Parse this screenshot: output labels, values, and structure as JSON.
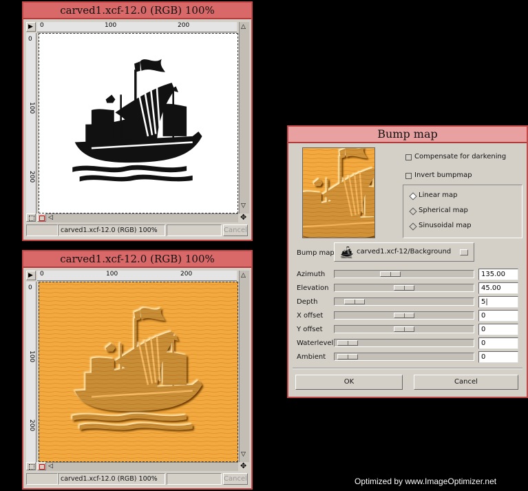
{
  "top_window": {
    "title": "carved1.xcf-12.0 (RGB) 100%",
    "ruler_h_labels": [
      "0",
      "100",
      "200"
    ],
    "ruler_v_labels": [
      "0",
      "100",
      "200"
    ],
    "status": "carved1.xcf-12.0 (RGB) 100%",
    "cancel_label": "Cancel",
    "nav_glyph": "✥",
    "menu_glyph": "▶",
    "left_arrow": "◁",
    "up_arrow": "△",
    "down_arrow": "▽"
  },
  "bottom_window": {
    "title": "carved1.xcf-12.0 (RGB) 100%",
    "ruler_h_labels": [
      "0",
      "100",
      "200"
    ],
    "ruler_v_labels": [
      "0",
      "100",
      "200"
    ],
    "status": "carved1.xcf-12.0 (RGB) 100%",
    "cancel_label": "Cancel",
    "nav_glyph": "✥",
    "menu_glyph": "▶",
    "left_arrow": "◁",
    "up_arrow": "△",
    "down_arrow": "▽"
  },
  "bump_dialog": {
    "title": "Bump map",
    "compensate_label": "Compensate for darkening",
    "compensate_checked": false,
    "invert_label": "Invert bumpmap",
    "invert_checked": false,
    "map_types": [
      {
        "label": "Linear map",
        "selected": true
      },
      {
        "label": "Spherical map",
        "selected": false
      },
      {
        "label": "Sinusoidal map",
        "selected": false
      }
    ],
    "bumpmap_label": "Bump map",
    "bumpmap_value": "carved1.xcf-12/Background",
    "params": [
      {
        "label": "Azimuth",
        "value": "135.00",
        "fraction": 0.375
      },
      {
        "label": "Elevation",
        "value": "45.00",
        "fraction": 0.5
      },
      {
        "label": "Depth",
        "value": "5|",
        "fraction": 0.06
      },
      {
        "label": "X offset",
        "value": "0",
        "fraction": 0.5
      },
      {
        "label": "Y offset",
        "value": "0",
        "fraction": 0.5
      },
      {
        "label": "Waterlevel",
        "value": "0",
        "fraction": 0.0
      },
      {
        "label": "Ambient",
        "value": "0",
        "fraction": 0.0
      }
    ],
    "ok_label": "OK",
    "cancel_label": "Cancel"
  },
  "footer_text": "Optimized by www.ImageOptimizer.net",
  "colors": {
    "title_bar": "#d96868",
    "window_border": "#c44848",
    "carved_bg": "#f0a83a",
    "ship_black": "#111111"
  }
}
